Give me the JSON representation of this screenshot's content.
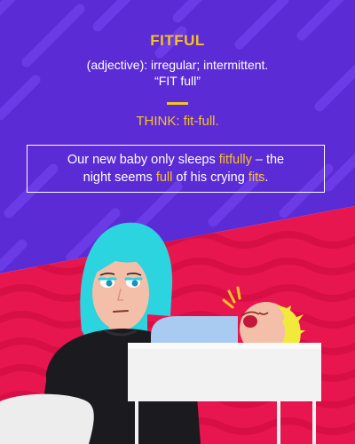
{
  "card": {
    "word": "FITFUL",
    "definition": "(adjective): irregular; intermittent.",
    "pronunciation": "“FIT full”",
    "think": "THINK: fit-full.",
    "sentence": {
      "line1_a": "Our new baby only sleeps ",
      "line1_hl": "fitfully",
      "line1_b": " – the",
      "line2_a": "night seems ",
      "line2_hl1": "full",
      "line2_b": " of his crying ",
      "line2_hl2": "fits",
      "line2_c": "."
    }
  },
  "colors": {
    "top_background": "#5B2BD6",
    "bottom_background": "#E8164E",
    "accent": "#F6C224",
    "text": "#FFFFFF",
    "hair": "#2BD4DE",
    "sweater": "#1A1A1F",
    "crib": "#F2F2F2",
    "blanket": "#A9CBF2"
  }
}
